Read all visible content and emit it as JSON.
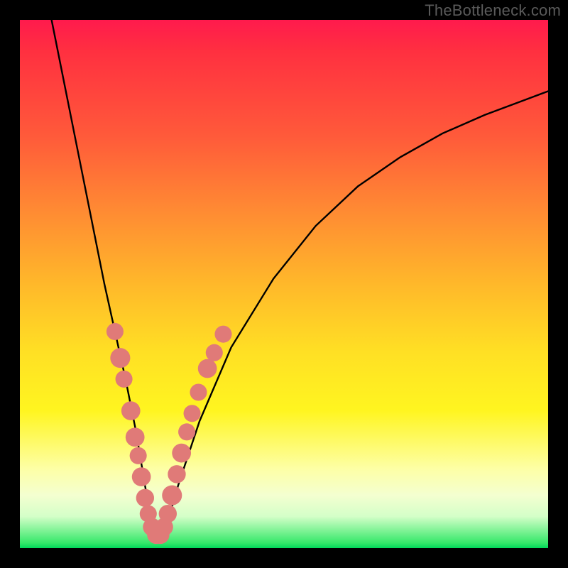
{
  "watermark": "TheBottleneck.com",
  "chart_data": {
    "type": "line",
    "title": "",
    "xlabel": "",
    "ylabel": "",
    "xlim": [
      0,
      100
    ],
    "ylim": [
      0,
      100
    ],
    "note": "No axes or tick labels rendered. Values estimated from pixel geometry where 0 = bottom/left, 100 = top/right.",
    "series": [
      {
        "name": "bottleneck-curve",
        "x": [
          6,
          8,
          10,
          12,
          14,
          16,
          18,
          20,
          22,
          23,
          24,
          25,
          26,
          27,
          28,
          30,
          34,
          40,
          48,
          56,
          64,
          72,
          80,
          88,
          96,
          100
        ],
        "y": [
          100,
          90,
          80,
          70,
          60,
          50,
          41,
          32,
          22,
          16,
          10,
          5,
          2,
          2,
          5,
          12,
          24,
          38,
          51,
          61,
          68.5,
          74,
          78.5,
          82,
          85,
          86.5
        ]
      }
    ],
    "markers": {
      "name": "highlighted-points",
      "color": "#e07a78",
      "points": [
        {
          "x": 18.0,
          "y": 41.0,
          "r": 1.2
        },
        {
          "x": 19.0,
          "y": 36.0,
          "r": 1.5
        },
        {
          "x": 19.7,
          "y": 32.0,
          "r": 1.2
        },
        {
          "x": 21.0,
          "y": 26.0,
          "r": 1.4
        },
        {
          "x": 21.8,
          "y": 21.0,
          "r": 1.4
        },
        {
          "x": 22.4,
          "y": 17.5,
          "r": 1.2
        },
        {
          "x": 23.0,
          "y": 13.5,
          "r": 1.4
        },
        {
          "x": 23.7,
          "y": 9.5,
          "r": 1.3
        },
        {
          "x": 24.3,
          "y": 6.5,
          "r": 1.2
        },
        {
          "x": 25.0,
          "y": 4.0,
          "r": 1.3
        },
        {
          "x": 25.8,
          "y": 2.5,
          "r": 1.3
        },
        {
          "x": 26.6,
          "y": 2.5,
          "r": 1.3
        },
        {
          "x": 27.3,
          "y": 4.0,
          "r": 1.3
        },
        {
          "x": 28.0,
          "y": 6.5,
          "r": 1.3
        },
        {
          "x": 28.8,
          "y": 10.0,
          "r": 1.5
        },
        {
          "x": 29.7,
          "y": 14.0,
          "r": 1.3
        },
        {
          "x": 30.6,
          "y": 18.0,
          "r": 1.4
        },
        {
          "x": 31.6,
          "y": 22.0,
          "r": 1.2
        },
        {
          "x": 32.6,
          "y": 25.5,
          "r": 1.2
        },
        {
          "x": 33.8,
          "y": 29.5,
          "r": 1.2
        },
        {
          "x": 35.5,
          "y": 34.0,
          "r": 1.4
        },
        {
          "x": 36.8,
          "y": 37.0,
          "r": 1.2
        },
        {
          "x": 38.5,
          "y": 40.5,
          "r": 1.2
        }
      ]
    }
  }
}
